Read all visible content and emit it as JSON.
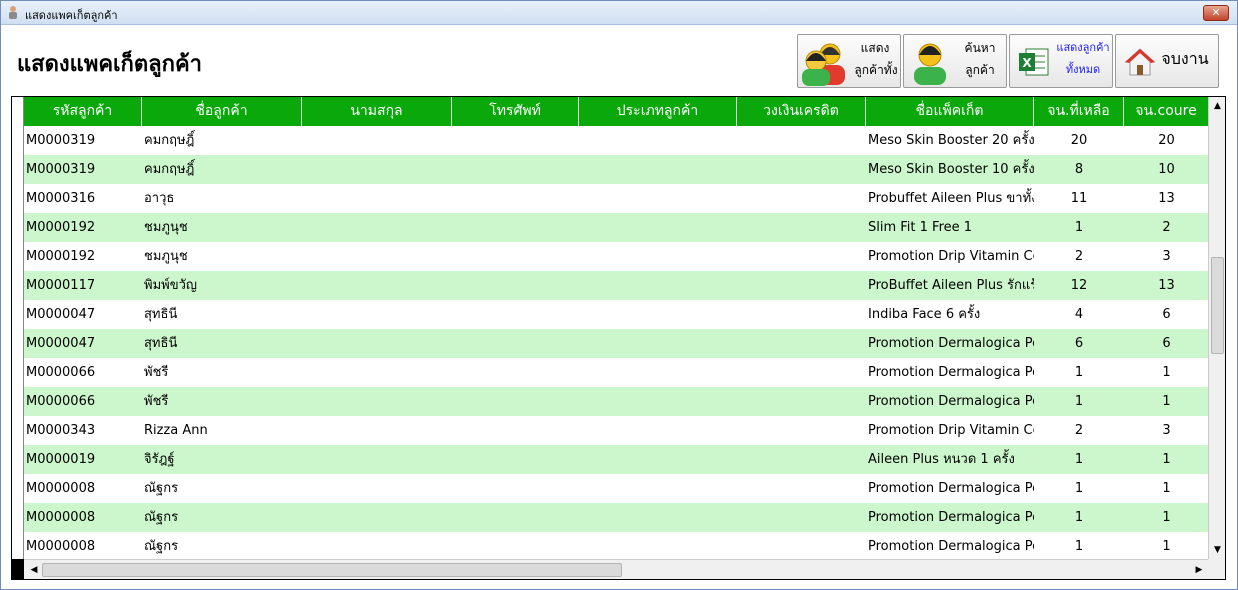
{
  "window": {
    "title": "แสดงแพคเก็ตลูกค้า"
  },
  "page": {
    "title": "แสดงแพคเก็ตลูกค้า"
  },
  "toolbar": {
    "show_all_line1": "แสดง",
    "show_all_line2": "ลูกค้าทั้ง",
    "search_line1": "ค้นหา",
    "search_line2": "ลูกค้า",
    "excel_line1": "แสดงลูกค้า",
    "excel_line2": "ทั้งหมด",
    "exit_label": "จบงาน"
  },
  "table": {
    "columns": [
      "รหัสลูกค้า",
      "ชื่อลูกค้า",
      "นามสกุล",
      "โทรศัพท์",
      "ประเภทลูกค้า",
      "วงเงินเครดิต",
      "ชื่อแพ็คเก็ต",
      "จน.ที่เหลือ",
      "จน.coure"
    ],
    "rows": [
      [
        "M0000319",
        "คมกฤษฎิ์",
        "",
        "",
        "",
        "",
        "Meso Skin Booster 20 ครั้ง",
        "20",
        "20"
      ],
      [
        "M0000319",
        "คมกฤษฎิ์",
        "",
        "",
        "",
        "",
        "Meso Skin Booster 10 ครั้ง",
        "8",
        "10"
      ],
      [
        "M0000316",
        "อาวุธ",
        "",
        "",
        "",
        "",
        "Probuffet Aileen Plus ขาทั้ง",
        "11",
        "13"
      ],
      [
        "M0000192",
        "ชมภูนุช",
        "",
        "",
        "",
        "",
        "Slim Fit 1 Free 1",
        "1",
        "2"
      ],
      [
        "M0000192",
        "ชมภูนุช",
        "",
        "",
        "",
        "",
        "Promotion Drip Vitamin Co",
        "2",
        "3"
      ],
      [
        "M0000117",
        "พิมพ์ขวัญ",
        "",
        "",
        "",
        "",
        "ProBuffet Aileen Plus รักแร้",
        "12",
        "13"
      ],
      [
        "M0000047",
        "สุทธินี",
        "",
        "",
        "",
        "",
        "Indiba Face 6 ครั้ง",
        "4",
        "6"
      ],
      [
        "M0000047",
        "สุทธินี",
        "",
        "",
        "",
        "",
        "Promotion Dermalogica Pe",
        "6",
        "6"
      ],
      [
        "M0000066",
        "พัชรี",
        "",
        "",
        "",
        "",
        "Promotion Dermalogica Pe",
        "1",
        "1"
      ],
      [
        "M0000066",
        "พัชรี",
        "",
        "",
        "",
        "",
        "Promotion Dermalogica Pe",
        "1",
        "1"
      ],
      [
        "M0000343",
        "Rizza Ann",
        "",
        "",
        "",
        "",
        "Promotion Drip Vitamin Co",
        "2",
        "3"
      ],
      [
        "M0000019",
        "จิรัฎฐ์",
        "",
        "",
        "",
        "",
        "Aileen Plus หนวด 1 ครั้ง",
        "1",
        "1"
      ],
      [
        "M0000008",
        "ณัฐกร",
        "",
        "",
        "",
        "",
        "Promotion Dermalogica Pe",
        "1",
        "1"
      ],
      [
        "M0000008",
        "ณัฐกร",
        "",
        "",
        "",
        "",
        "Promotion Dermalogica Pe",
        "1",
        "1"
      ],
      [
        "M0000008",
        "ณัฐกร",
        "",
        "",
        "",
        "",
        "Promotion Dermalogica Pe",
        "1",
        "1"
      ]
    ]
  },
  "colors": {
    "header_bg": "#0aa80a",
    "row_alt_bg": "#ccf7cc",
    "excel_label": "#1a1aff"
  }
}
